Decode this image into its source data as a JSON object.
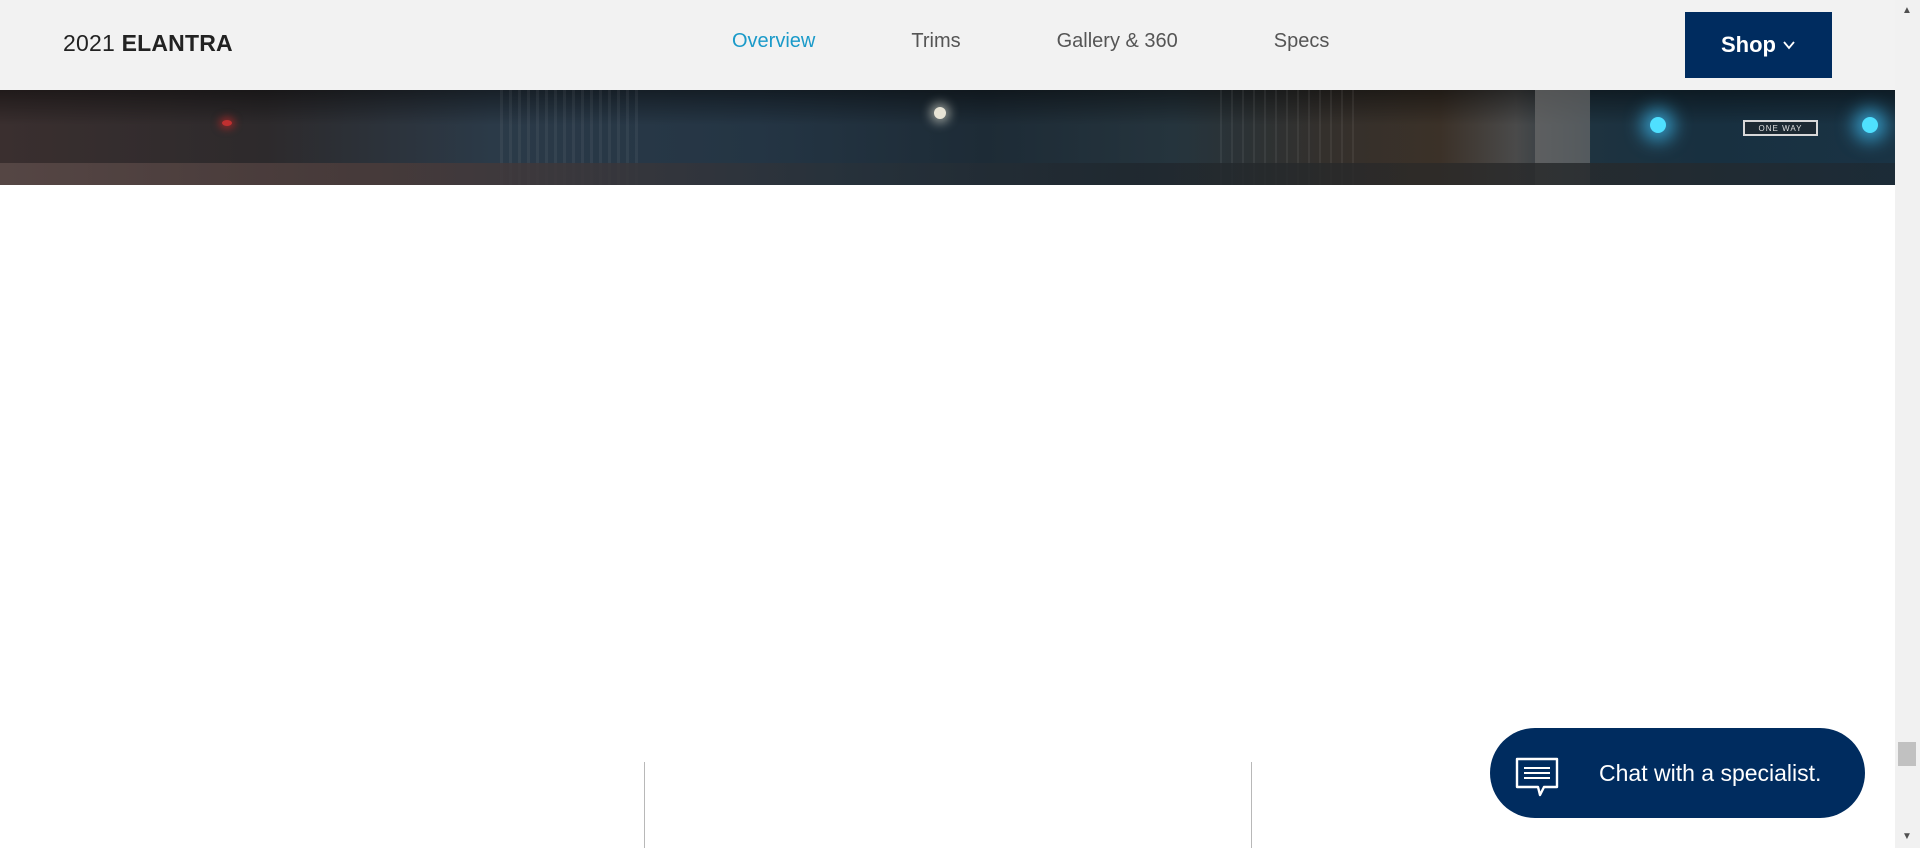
{
  "header": {
    "model_year": "2021",
    "model_name": "ELANTRA",
    "nav": [
      {
        "label": "Overview",
        "active": true
      },
      {
        "label": "Trims",
        "active": false
      },
      {
        "label": "Gallery & 360",
        "active": false
      },
      {
        "label": "Specs",
        "active": false
      }
    ],
    "shop_label": "Shop",
    "shop_icon": "chevron-down-icon"
  },
  "hero": {
    "sign_text": "ONE WAY"
  },
  "chat": {
    "label": "Chat with a specialist.",
    "icon": "chat-bubble-icon"
  },
  "scrollbar": {
    "up_icon": "▲",
    "down_icon": "▼"
  },
  "colors": {
    "brand_navy": "#002c5f",
    "active_link": "#1a9ac9",
    "topbar_bg": "#f2f2f2"
  }
}
